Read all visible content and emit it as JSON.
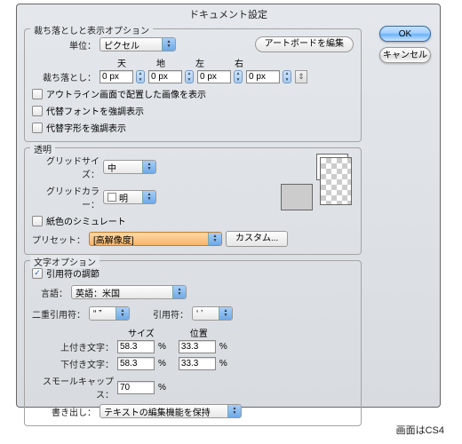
{
  "title": "ドキュメント設定",
  "buttons": {
    "ok": "OK",
    "cancel": "キャンセル"
  },
  "bleed": {
    "legend": "裁ち落としと表示オプション",
    "unit_label": "単位：",
    "unit_value": "ピクセル",
    "edit_artboard": "アートボードを編集",
    "bleed_label": "裁ち落とし：",
    "cols": {
      "top": "天",
      "bottom": "地",
      "left": "左",
      "right": "右"
    },
    "vals": {
      "top": "0 px",
      "bottom": "0 px",
      "left": "0 px",
      "right": "0 px"
    },
    "opt1": "アウトライン画面で配置した画像を表示",
    "opt2": "代替フォントを強調表示",
    "opt3": "代替字形を強調表示"
  },
  "trans": {
    "legend": "透明",
    "grid_size_label": "グリッドサイズ：",
    "grid_size_value": "中",
    "grid_color_label": "グリッドカラー：",
    "grid_color_value": "明",
    "simulate": "紙色のシミュレート",
    "preset_label": "プリセット：",
    "preset_value": "[高解像度]",
    "custom": "カスタム..."
  },
  "type": {
    "legend": "文字オプション",
    "quotes": "引用符の調節",
    "lang_label": "言語：",
    "lang_value": "英語：米国",
    "double_quote_label": "二重引用符：",
    "double_quote_value": "“ ”",
    "single_quote_label": "引用符：",
    "single_quote_value": "‘ ’",
    "col_size": "サイズ",
    "col_position": "位置",
    "superscript": "上付き文字：",
    "subscript": "下付き文字：",
    "smallcaps": "スモールキャップス：",
    "export_label": "書き出し：",
    "export_value": "テキストの編集機能を保持",
    "v_superscript_size": "58.3",
    "v_superscript_pos": "33.3",
    "v_subscript_size": "58.3",
    "v_subscript_pos": "33.3",
    "v_smallcaps": "70"
  },
  "footer": "画面はCS4"
}
